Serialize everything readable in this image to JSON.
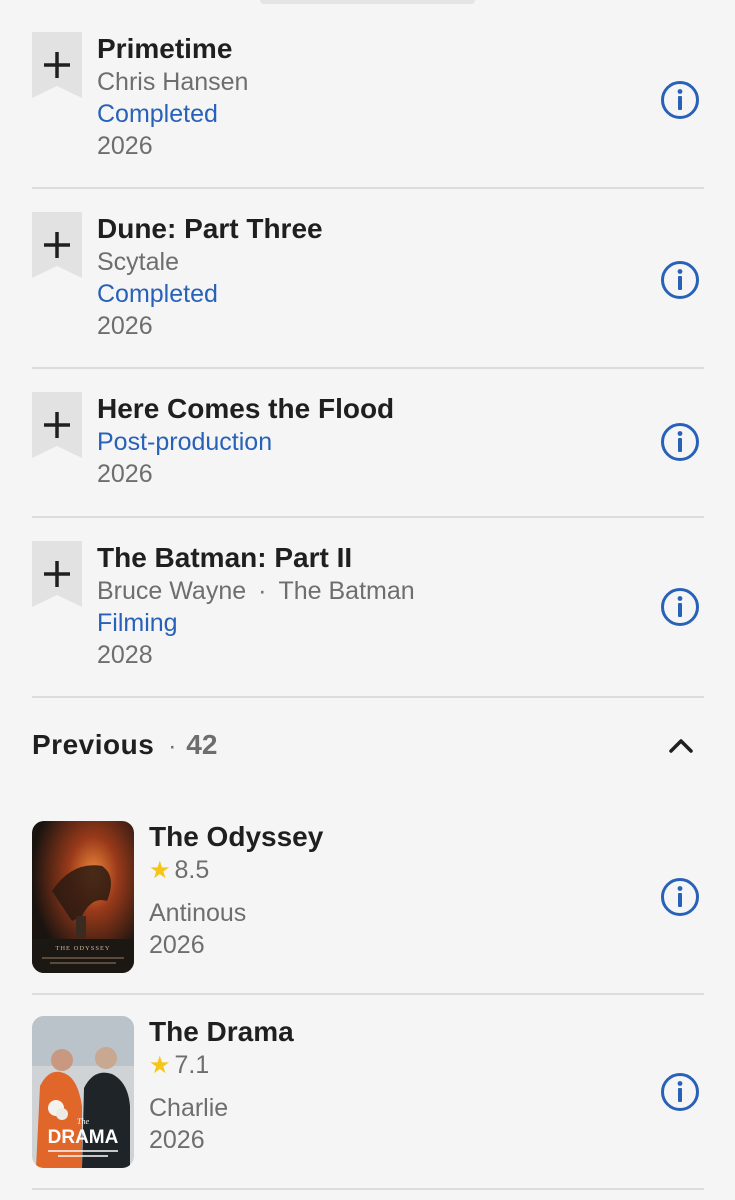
{
  "upcoming": [
    {
      "title": "Primetime",
      "role": "Chris Hansen",
      "status": "Completed",
      "year": "2026"
    },
    {
      "title": "Dune: Part Three",
      "role": "Scytale",
      "status": "Completed",
      "year": "2026"
    },
    {
      "title": "Here Comes the Flood",
      "status": "Post-production",
      "year": "2026"
    },
    {
      "title": "The Batman: Part II",
      "role": "Bruce Wayne",
      "role2": "The Batman",
      "separator": "·",
      "status": "Filming",
      "year": "2028"
    }
  ],
  "previous": {
    "label": "Previous",
    "separator": "·",
    "count": "42",
    "items": [
      {
        "title": "The Odyssey",
        "rating": "8.5",
        "role": "Antinous",
        "year": "2026",
        "poster_text": "THE ODYSSEY"
      },
      {
        "title": "The Drama",
        "rating": "7.1",
        "role": "Charlie",
        "year": "2026",
        "poster_text": "DRAMA",
        "poster_text_small": "The"
      }
    ]
  },
  "icons": {
    "add": "bookmark-plus-icon",
    "info": "info-circle-icon",
    "collapse": "chevron-up-icon",
    "star": "star-icon"
  },
  "colors": {
    "status": "#2862b8",
    "info": "#2862b8",
    "star": "#f5c518",
    "divider": "#dcdcdc",
    "background": "#f5f5f5"
  }
}
